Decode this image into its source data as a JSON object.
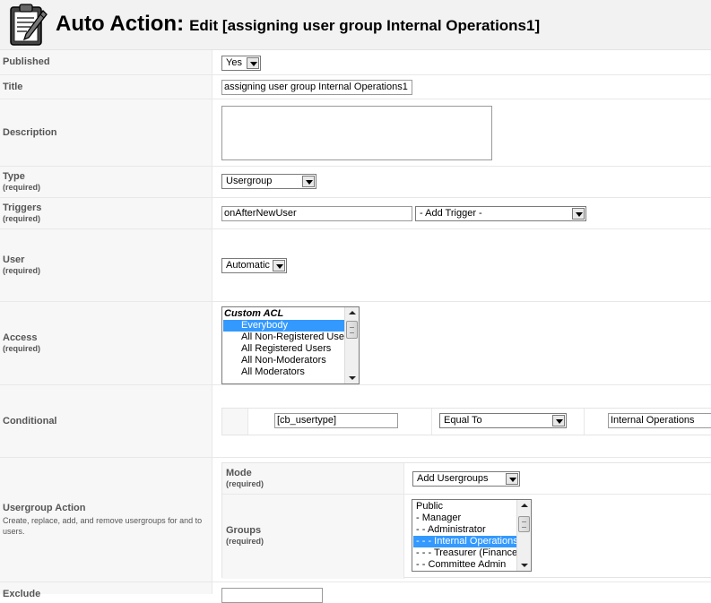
{
  "header": {
    "title": "Auto Action:",
    "subtitle": "Edit [assigning user group Internal Operations1]",
    "icon": "clipboard-pencil-icon"
  },
  "form": {
    "published": {
      "label": "Published",
      "value": "Yes"
    },
    "title": {
      "label": "Title",
      "value": "assigning user group Internal Operations1"
    },
    "description": {
      "label": "Description",
      "value": ""
    },
    "type": {
      "label": "Type",
      "required": "(required)",
      "value": "Usergroup"
    },
    "triggers": {
      "label": "Triggers",
      "required": "(required)",
      "value": "onAfterNewUser",
      "add_trigger": "- Add Trigger -"
    },
    "user": {
      "label": "User",
      "required": "(required)",
      "value": "Automatic"
    },
    "access": {
      "label": "Access",
      "required": "(required)",
      "options": [
        {
          "text": "Custom ACL",
          "group": true
        },
        {
          "text": "Everybody",
          "selected": true
        },
        {
          "text": "All Non-Registered Users"
        },
        {
          "text": "All Registered Users"
        },
        {
          "text": "All Non-Moderators"
        },
        {
          "text": "All Moderators"
        }
      ]
    },
    "conditional": {
      "label": "Conditional",
      "field": "[cb_usertype]",
      "operator": "Equal To",
      "value": "Internal Operations"
    },
    "usergroup_action": {
      "label": "Usergroup Action",
      "description": "Create, replace, add, and remove usergroups for and to users.",
      "mode": {
        "label": "Mode",
        "required": "(required)",
        "value": "Add Usergroups"
      },
      "groups": {
        "label": "Groups",
        "required": "(required)",
        "options": [
          {
            "text": "Public"
          },
          {
            "text": "- Manager"
          },
          {
            "text": "- - Administrator"
          },
          {
            "text": "- - - Internal Operations",
            "selected": true
          },
          {
            "text": "- - - Treasurer (Finance)"
          },
          {
            "text": "- - Committee Admin"
          }
        ]
      }
    },
    "exclude": {
      "label": "Exclude"
    }
  }
}
